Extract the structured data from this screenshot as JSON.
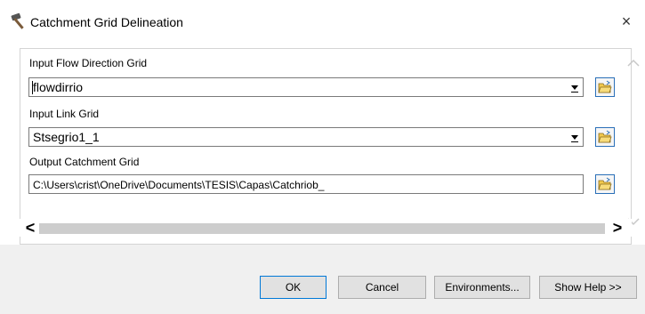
{
  "window": {
    "title": "Catchment Grid Delineation",
    "close_glyph": "×"
  },
  "fields": {
    "flow_direction": {
      "label": "Input Flow Direction Grid",
      "value": "flowdirrio"
    },
    "link_grid": {
      "label": "Input Link Grid",
      "value": "Stsegrio1_1"
    },
    "output": {
      "label": "Output Catchment Grid",
      "value": "C:\\Users\\crist\\OneDrive\\Documents\\TESIS\\Capas\\Catchriob_"
    }
  },
  "buttons": {
    "ok": "OK",
    "cancel": "Cancel",
    "environments": "Environments...",
    "show_help": "Show Help >>"
  },
  "scroll": {
    "left_glyph": "<",
    "right_glyph": ">"
  },
  "icons": {
    "title": "hammer-icon",
    "browse": "open-folder-icon"
  },
  "colors": {
    "footer_bg": "#f0f0f0",
    "focus_border": "#0078d7",
    "browse_border": "#2a6fb8",
    "folder_yellow": "#f2c94c"
  }
}
